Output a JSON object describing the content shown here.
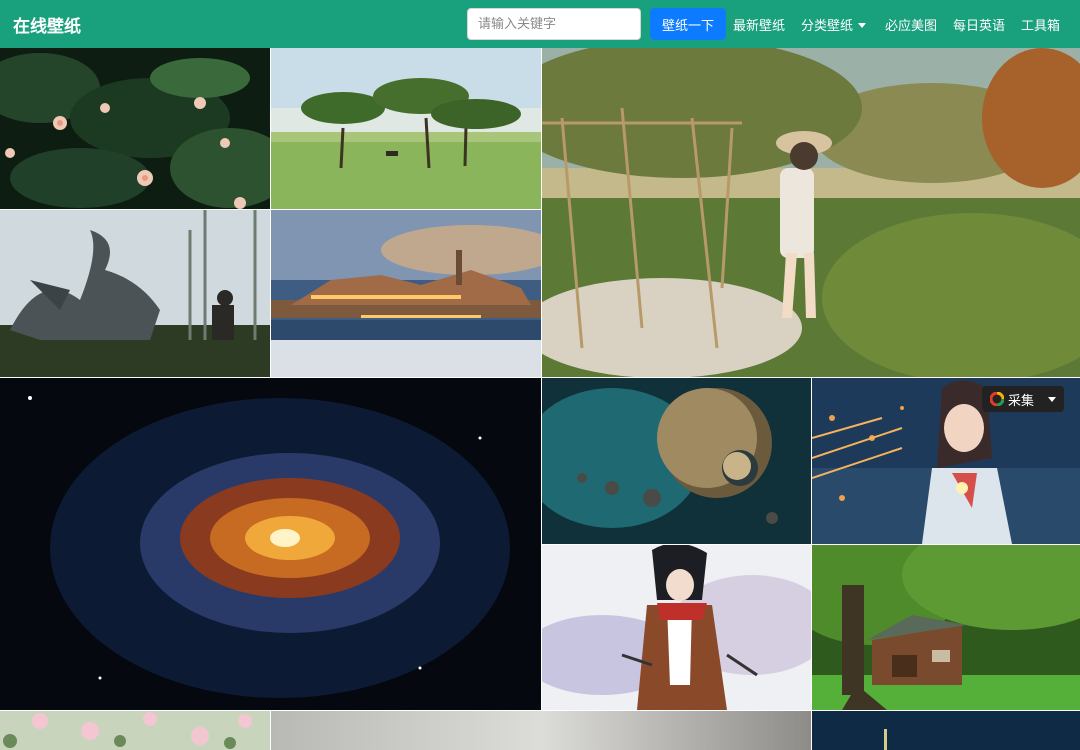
{
  "header": {
    "brand": "在线壁纸",
    "search_placeholder": "请输入关键字",
    "search_button": "壁纸一下",
    "nav": [
      "最新壁纸",
      "分类壁纸",
      "必应美图",
      "每日英语",
      "工具箱"
    ]
  },
  "overlay": {
    "collect_label": "采集"
  },
  "colors": {
    "navbar": "#19a07d",
    "search_button": "#0d7bff",
    "collect_bg": "#222222"
  },
  "tiles": [
    "flowering-shrub",
    "acacia-savanna",
    "anime-girl-field",
    "dragon-knight",
    "castle-lakeside",
    "galaxy-spiral",
    "planet-asteroids",
    "anime-girl-sparkler",
    "anime-warrior",
    "tree-cabin",
    "cherry-blossom",
    "grey-mist",
    "night-sky"
  ]
}
